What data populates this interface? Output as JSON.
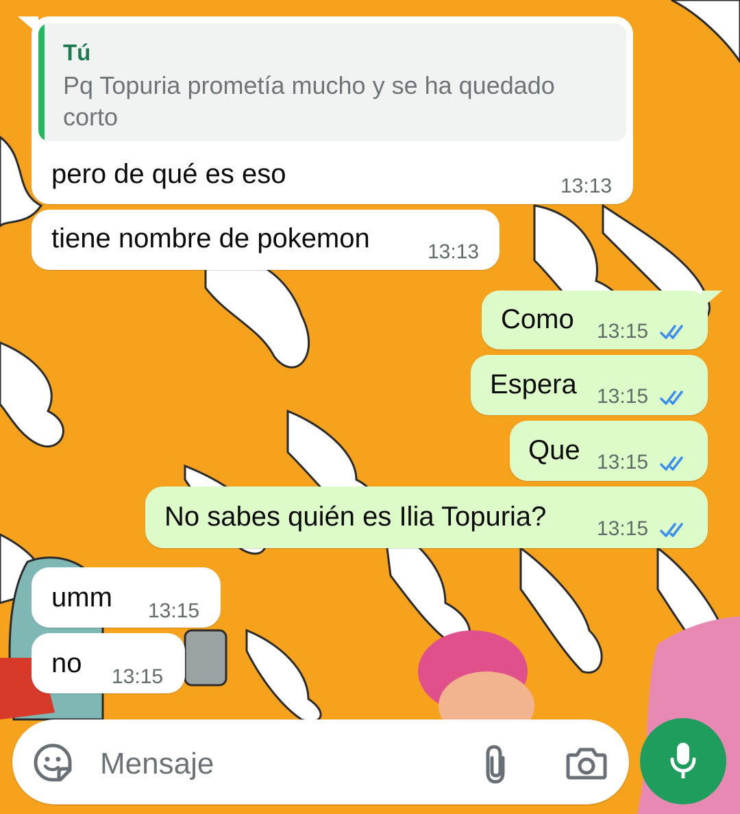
{
  "colors": {
    "wallpaper": "#f6a21c",
    "incoming_bubble": "#ffffff",
    "outgoing_bubble": "#dcfbc9",
    "read_ticks": "#3b8ef0",
    "accent": "#1f9d5c"
  },
  "messages": [
    {
      "direction": "incoming",
      "reply_to": {
        "author": "Tú",
        "text": "Pq Topuria prometía mucho y se ha quedado corto"
      },
      "text": "pero de qué es eso",
      "time": "13:13"
    },
    {
      "direction": "incoming",
      "text": "tiene nombre de pokemon",
      "time": "13:13"
    },
    {
      "direction": "outgoing",
      "text": "Como",
      "time": "13:15",
      "status": "read"
    },
    {
      "direction": "outgoing",
      "text": "Espera",
      "time": "13:15",
      "status": "read"
    },
    {
      "direction": "outgoing",
      "text": "Que",
      "time": "13:15",
      "status": "read"
    },
    {
      "direction": "outgoing",
      "text": "No sabes quién es Ilia Topuria?",
      "time": "13:15",
      "status": "read"
    },
    {
      "direction": "incoming",
      "text": "umm",
      "time": "13:15"
    },
    {
      "direction": "incoming",
      "text": "no",
      "time": "13:15"
    }
  ],
  "composer": {
    "placeholder": "Mensaje",
    "icons": [
      "sticker-icon",
      "paperclip-icon",
      "camera-icon",
      "microphone-icon"
    ]
  }
}
